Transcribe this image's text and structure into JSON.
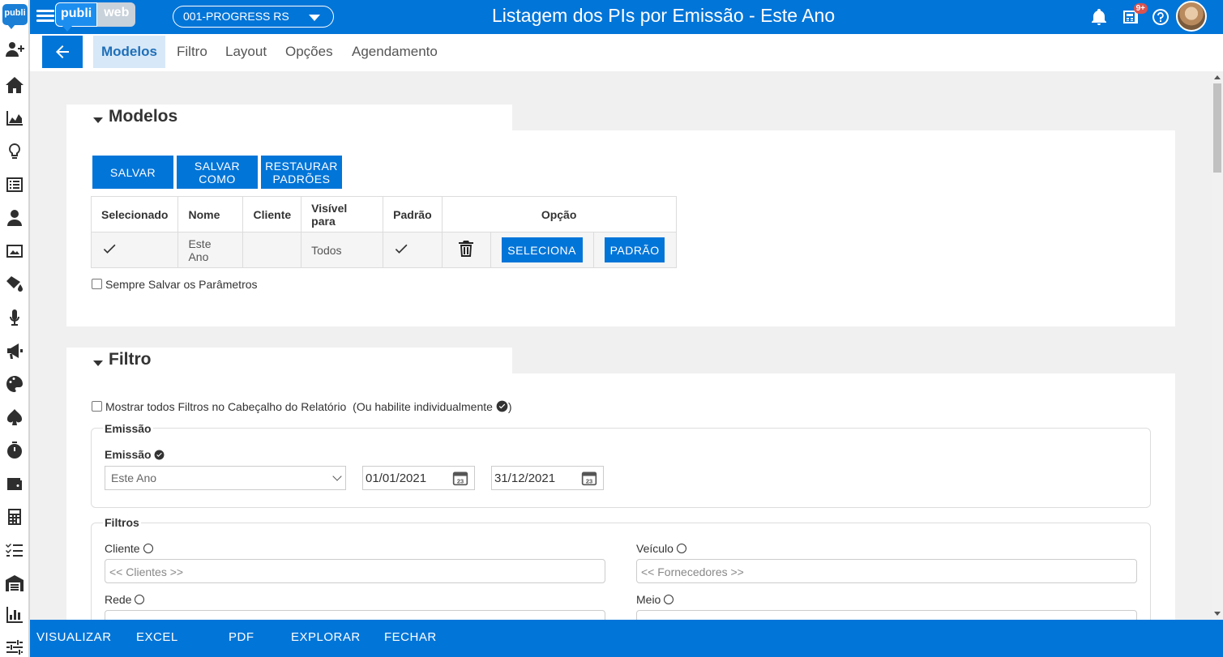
{
  "sidebar": {
    "logo_text": "publi",
    "icons": [
      "add-user-icon",
      "home-icon",
      "area-chart-icon",
      "lightbulb-icon",
      "list-icon",
      "user-icon",
      "media-icon",
      "paint-bucket-icon",
      "microphone-icon",
      "megaphone-icon",
      "palette-icon",
      "spade-icon",
      "stopwatch-icon",
      "wallet-icon",
      "calculator-icon",
      "checklist-icon",
      "warehouse-icon",
      "bar-chart-icon",
      "sliders-icon"
    ]
  },
  "header": {
    "brand_left": "publi",
    "brand_right": "web",
    "company": "001-PROGRESS RS",
    "title": "Listagem dos PIs por Emissão - Este Ano",
    "notification_badge": "9+"
  },
  "tabs": [
    "Modelos",
    "Filtro",
    "Layout",
    "Opções",
    "Agendamento"
  ],
  "modelos": {
    "title": "Modelos",
    "buttons": {
      "save": "SALVAR",
      "save_as": "SALVAR COMO",
      "restore": "RESTAURAR PADRÕES"
    },
    "columns": [
      "Selecionado",
      "Nome",
      "Cliente",
      "Visível para",
      "Padrão",
      "Opção"
    ],
    "rows": [
      {
        "name": "Este Ano",
        "client": "",
        "visible_to": "Todos",
        "select_label": "SELECIONA",
        "default_label": "PADRÃO"
      }
    ],
    "always_save_label": "Sempre Salvar os Parâmetros"
  },
  "filtro": {
    "title": "Filtro",
    "show_all_label": "Mostrar todos Filtros no Cabeçalho do Relatório",
    "show_all_hint": "(Ou habilite individualmente",
    "show_all_hint_end": ")",
    "emissao": {
      "legend": "Emissão",
      "label": "Emissão",
      "period": "Este Ano",
      "date_from": "01/01/2021",
      "date_to": "31/12/2021",
      "calendar_day": "23"
    },
    "filtros": {
      "legend": "Filtros",
      "cliente_label": "Cliente",
      "cliente_placeholder": "<< Clientes >>",
      "veiculo_label": "Veículo",
      "veiculo_placeholder": "<< Fornecedores >>",
      "rede_label": "Rede",
      "meio_label": "Meio"
    }
  },
  "bottom_bar": [
    "VISUALIZAR",
    "EXCEL",
    "PDF",
    "EXPLORAR",
    "FECHAR"
  ],
  "colors": {
    "primary": "#0275d8",
    "tab_active_bg": "#d7e8f8"
  }
}
